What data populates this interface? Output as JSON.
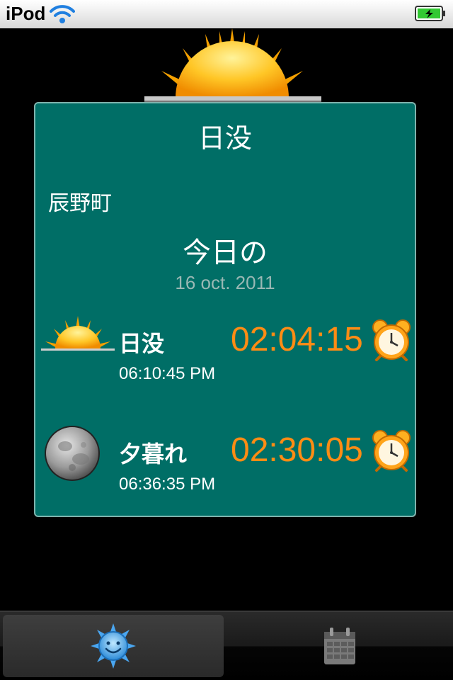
{
  "status_bar": {
    "device_name": "iPod"
  },
  "panel": {
    "title": "日没",
    "location": "辰野町",
    "heading": "今日の",
    "date": "16 oct. 2011"
  },
  "events": [
    {
      "name": "日没",
      "time": "06:10:45 PM",
      "countdown": "02:04:15",
      "icon": "sunset-icon"
    },
    {
      "name": "夕暮れ",
      "time": "06:36:35 PM",
      "countdown": "02:30:05",
      "icon": "moon-icon"
    }
  ],
  "tabs": [
    {
      "id": "today",
      "icon": "sun-face-icon",
      "selected": true
    },
    {
      "id": "calendar",
      "icon": "calendar-icon",
      "selected": false
    }
  ],
  "colors": {
    "panel_background": "#006e66",
    "countdown": "#ff8c14",
    "date_text": "#99b8b4"
  }
}
